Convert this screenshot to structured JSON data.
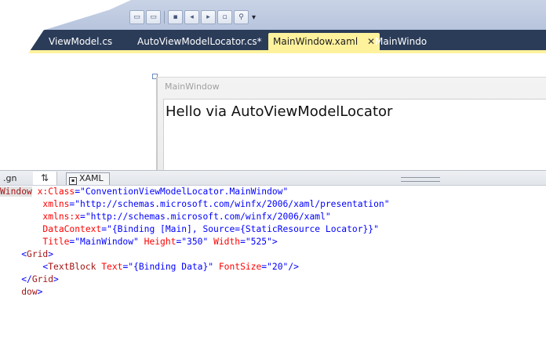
{
  "toolbar": {
    "buttons": [
      "comment-icon",
      "uncomment-icon",
      "bookmark-icon",
      "prev-bookmark-icon",
      "next-bookmark-icon",
      "clear-bookmarks-icon",
      "find-icon"
    ],
    "overflow": "▾"
  },
  "tabs": [
    {
      "label": "ViewModel.cs"
    },
    {
      "label": "AutoViewModelLocator.cs*"
    },
    {
      "label": "MainWindow.xaml",
      "close": "✕"
    },
    {
      "label": "MainWindo"
    }
  ],
  "designer": {
    "window_title": "MainWindow",
    "content_text": "Hello via AutoViewModelLocator"
  },
  "splitter": {
    "design_label": ".gn",
    "swap_glyph": "⇅",
    "xaml_label": "XAML"
  },
  "editor": {
    "lines": [
      {
        "a": "Window",
        "b": " x:Class",
        "c": "=\"ConventionViewModelLocator.MainWindow\""
      },
      {
        "a": "        xmlns",
        "b": "=\"http://schemas.microsoft.com/winfx/2006/xaml/presentation\""
      },
      {
        "a": "        xmlns:x",
        "b": "=\"http://schemas.microsoft.com/winfx/2006/xaml\""
      },
      {
        "a": "        DataContext",
        "b": "=\"{Binding [Main], Source={StaticResource Locator}}\""
      },
      {
        "a": "        Title",
        "b": "=\"MainWindow\"",
        "c": " Height",
        "d": "=\"350\"",
        "e": " Width",
        "f": "=\"525\"",
        "g": ">"
      },
      {
        "a": "    <",
        "b": "Grid",
        "c": ">"
      },
      {
        "a": "        <",
        "b": "TextBlock",
        "c": " Text",
        "d": "=\"{Binding Data}\"",
        "e": " FontSize",
        "f": "=\"20\"",
        "g": "/>"
      },
      {
        "a": "    </",
        "b": "Grid",
        "c": ">"
      },
      {
        "a": "    ",
        "b": "dow",
        "c": ">"
      }
    ]
  },
  "colors": {
    "tab_bar": "#2b3c59",
    "active_tab": "#fff29d",
    "xaml_element": "#a31515",
    "xaml_attribute": "#ff0000",
    "xaml_value": "#0000ff"
  }
}
